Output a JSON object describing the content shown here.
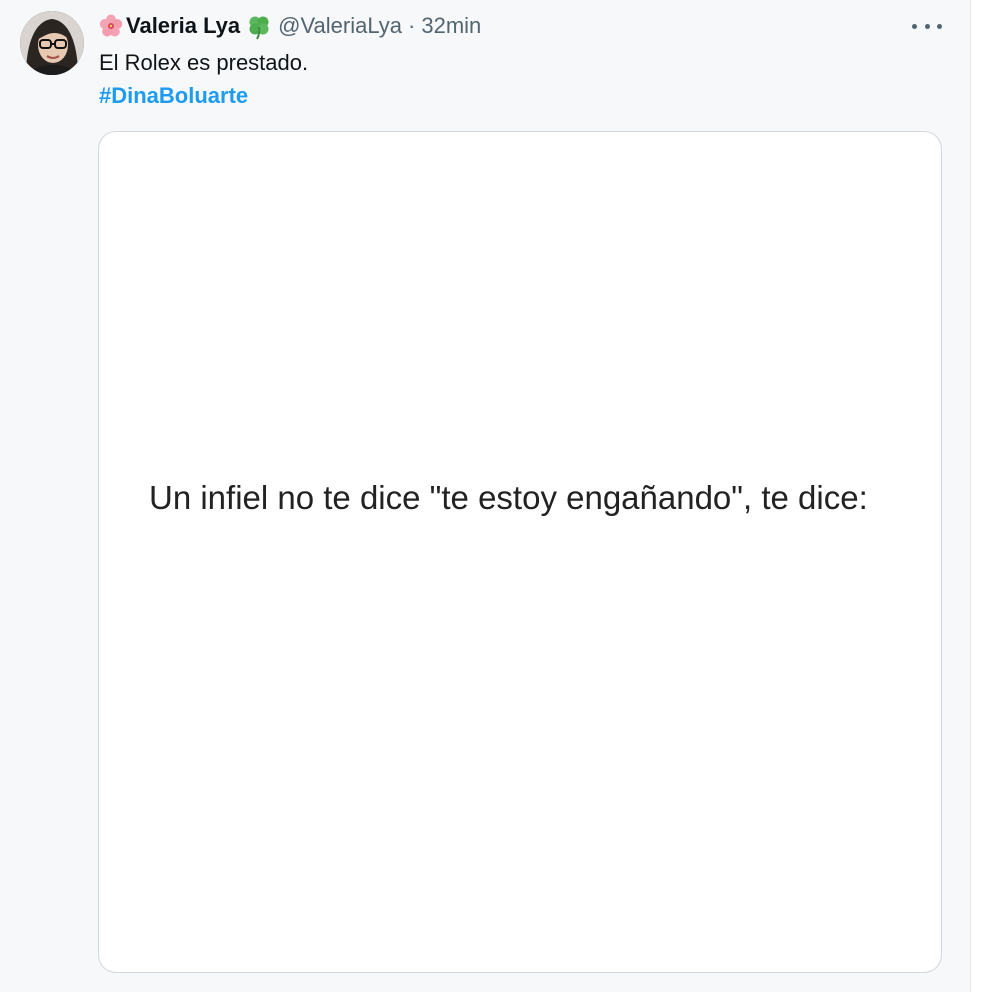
{
  "author": {
    "display_name": "Valeria Lya",
    "handle": "@ValeriaLya",
    "separator": "·",
    "time": "32min",
    "name_prefix_icon": "hibiscus-icon",
    "name_suffix_icon": "four-leaf-clover-icon"
  },
  "tweet": {
    "text": "El Rolex es prestado.",
    "hashtag": "#DinaBoluarte"
  },
  "media": {
    "text": "Un infiel no te dice \"te estoy engañando\", te dice:"
  },
  "colors": {
    "background": "#f7f8f9",
    "link": "#1d9bf0",
    "secondary_text": "#536471",
    "card_border": "#cfd9de"
  }
}
